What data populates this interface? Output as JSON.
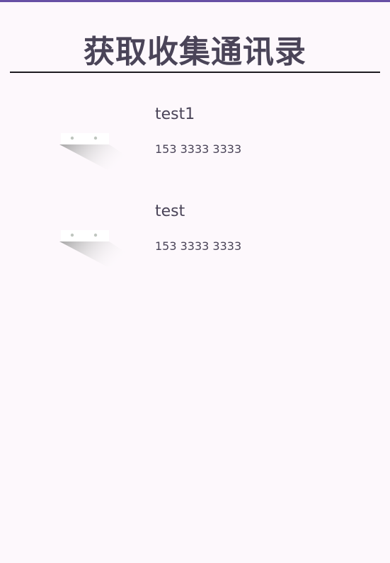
{
  "header": {
    "title": "获取收集通讯录"
  },
  "contacts": [
    {
      "name": "test1",
      "phone": "153 3333 3333",
      "avatar_icon": "contact-card-icon"
    },
    {
      "name": "test",
      "phone": "153 3333 3333",
      "avatar_icon": "contact-card-icon"
    }
  ],
  "colors": {
    "accent": "#6750a4",
    "background": "#fdf8fc",
    "text": "#4a4458",
    "rule": "#1c1b1f"
  }
}
